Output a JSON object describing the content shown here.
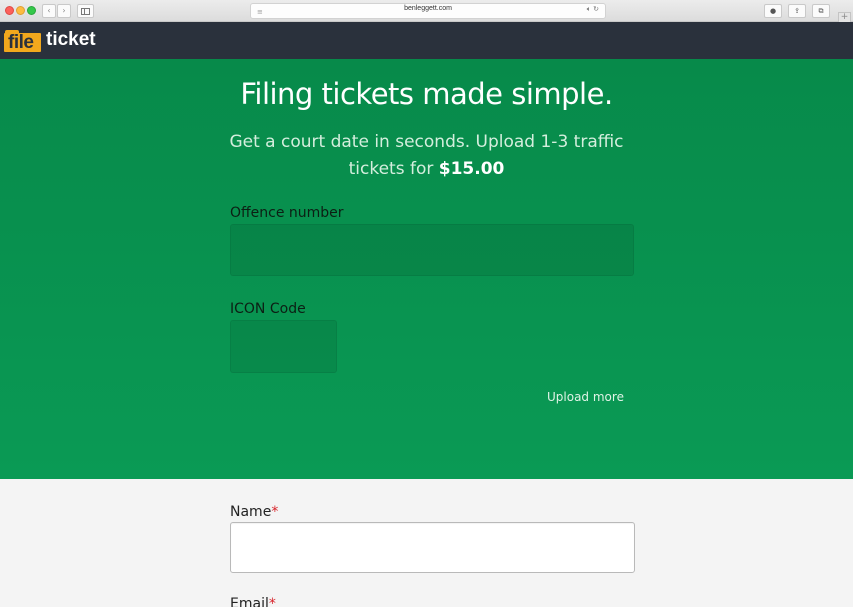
{
  "browser": {
    "url": "benleggett.com",
    "plus_label": "+"
  },
  "site": {
    "logo_file": "file",
    "logo_ticket": "ticket"
  },
  "hero": {
    "headline": "Filing tickets made simple.",
    "subline_before": "Get a court date in seconds. Upload 1-3 traffic tickets for ",
    "price": "$15.00"
  },
  "ticket_form": {
    "offence_label": "Offence number",
    "offence_value": "",
    "icon_code_label": "ICON Code",
    "icon_code_value": "",
    "upload_more_label": "Upload more"
  },
  "contact_form": {
    "name_label": "Name",
    "name_required_mark": "*",
    "name_value": "",
    "email_label": "Email",
    "email_required_mark": "*"
  },
  "colors": {
    "nav_bg": "#2a313c",
    "brand_orange": "#f2a81d",
    "hero_green": "#0a9a55",
    "required_red": "#d8232a"
  }
}
